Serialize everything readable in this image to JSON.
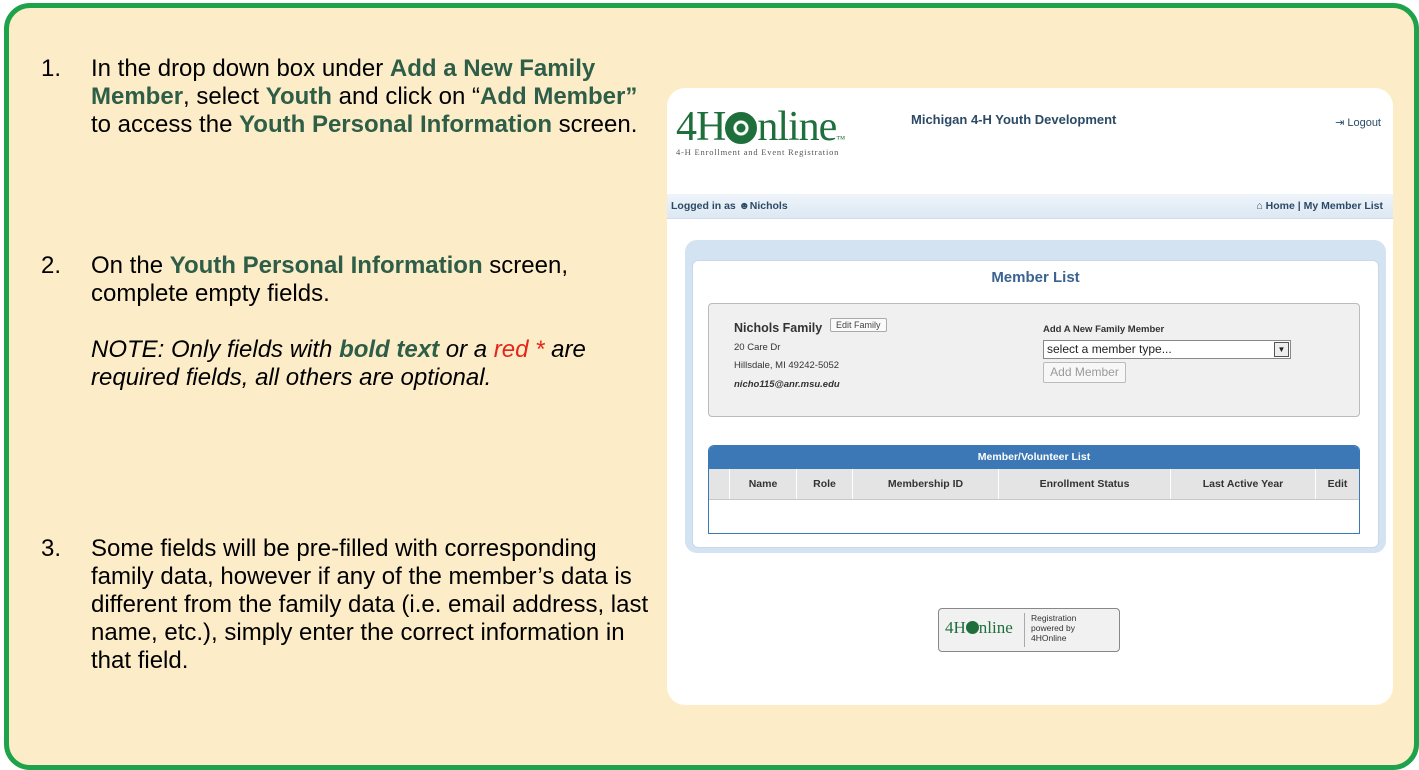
{
  "steps": [
    {
      "num": "1.",
      "t1": "In the drop down box under ",
      "b1": "Add a New Family Member",
      "t2": ", select ",
      "b2": "Youth",
      "t3": " and click on “",
      "b3": "Add Member”",
      "t4": " to access the ",
      "b4": "Youth Personal Information",
      "t5": " screen."
    },
    {
      "num": "2.",
      "t1": "On the ",
      "b1": "Youth Personal Information",
      "t2": " screen, complete empty fields.",
      "note1": "NOTE: Only fields with ",
      "note_bold": "bold text",
      "note2": " or a ",
      "note_red": "red *",
      "note3": " are required fields, all others are optional."
    },
    {
      "num": "3.",
      "text": "Some fields will be pre-filled with corresponding family data, however if any of the member’s data is different from the family data (i.e. email address, last name, etc.), simply enter the correct information in that field."
    }
  ],
  "app": {
    "logo_prefix": "4H",
    "logo_suffix": "nline",
    "logo_tm": "™",
    "logo_sub": "4-H Enrollment and Event Registration",
    "title": "Michigan 4-H Youth Development",
    "logout_icon": "logout-icon",
    "logout": "Logout",
    "logged_in_as": "Logged in as",
    "user_icon": "user-icon",
    "user": "Nichols",
    "home_icon": "home-icon",
    "home": "Home",
    "nav_sep": "|",
    "member_list_link": "My Member List",
    "panel_title": "Member List",
    "family": {
      "name": "Nichols Family",
      "edit": "Edit Family",
      "street": "20 Care Dr",
      "city": "Hillsdale, MI 49242-5052",
      "email": "nicho115@anr.msu.edu"
    },
    "add": {
      "label": "Add A New Family Member",
      "select_value": "select a member type...",
      "button": "Add Member"
    },
    "table": {
      "title": "Member/Volunteer List",
      "columns": [
        "Name",
        "Role",
        "Membership ID",
        "Enrollment Status",
        "Last Active Year",
        "Edit"
      ]
    },
    "badge": {
      "logo_prefix": "4H",
      "logo_suffix": "nline",
      "line1": "Registration",
      "line2": "powered by",
      "line3": "4HOnline"
    }
  },
  "colors": {
    "border": "#1ea34a",
    "card_bg": "#fcedc8",
    "highlight": "#2e5e47",
    "required": "#e3261c",
    "table_header": "#3c78b5"
  }
}
